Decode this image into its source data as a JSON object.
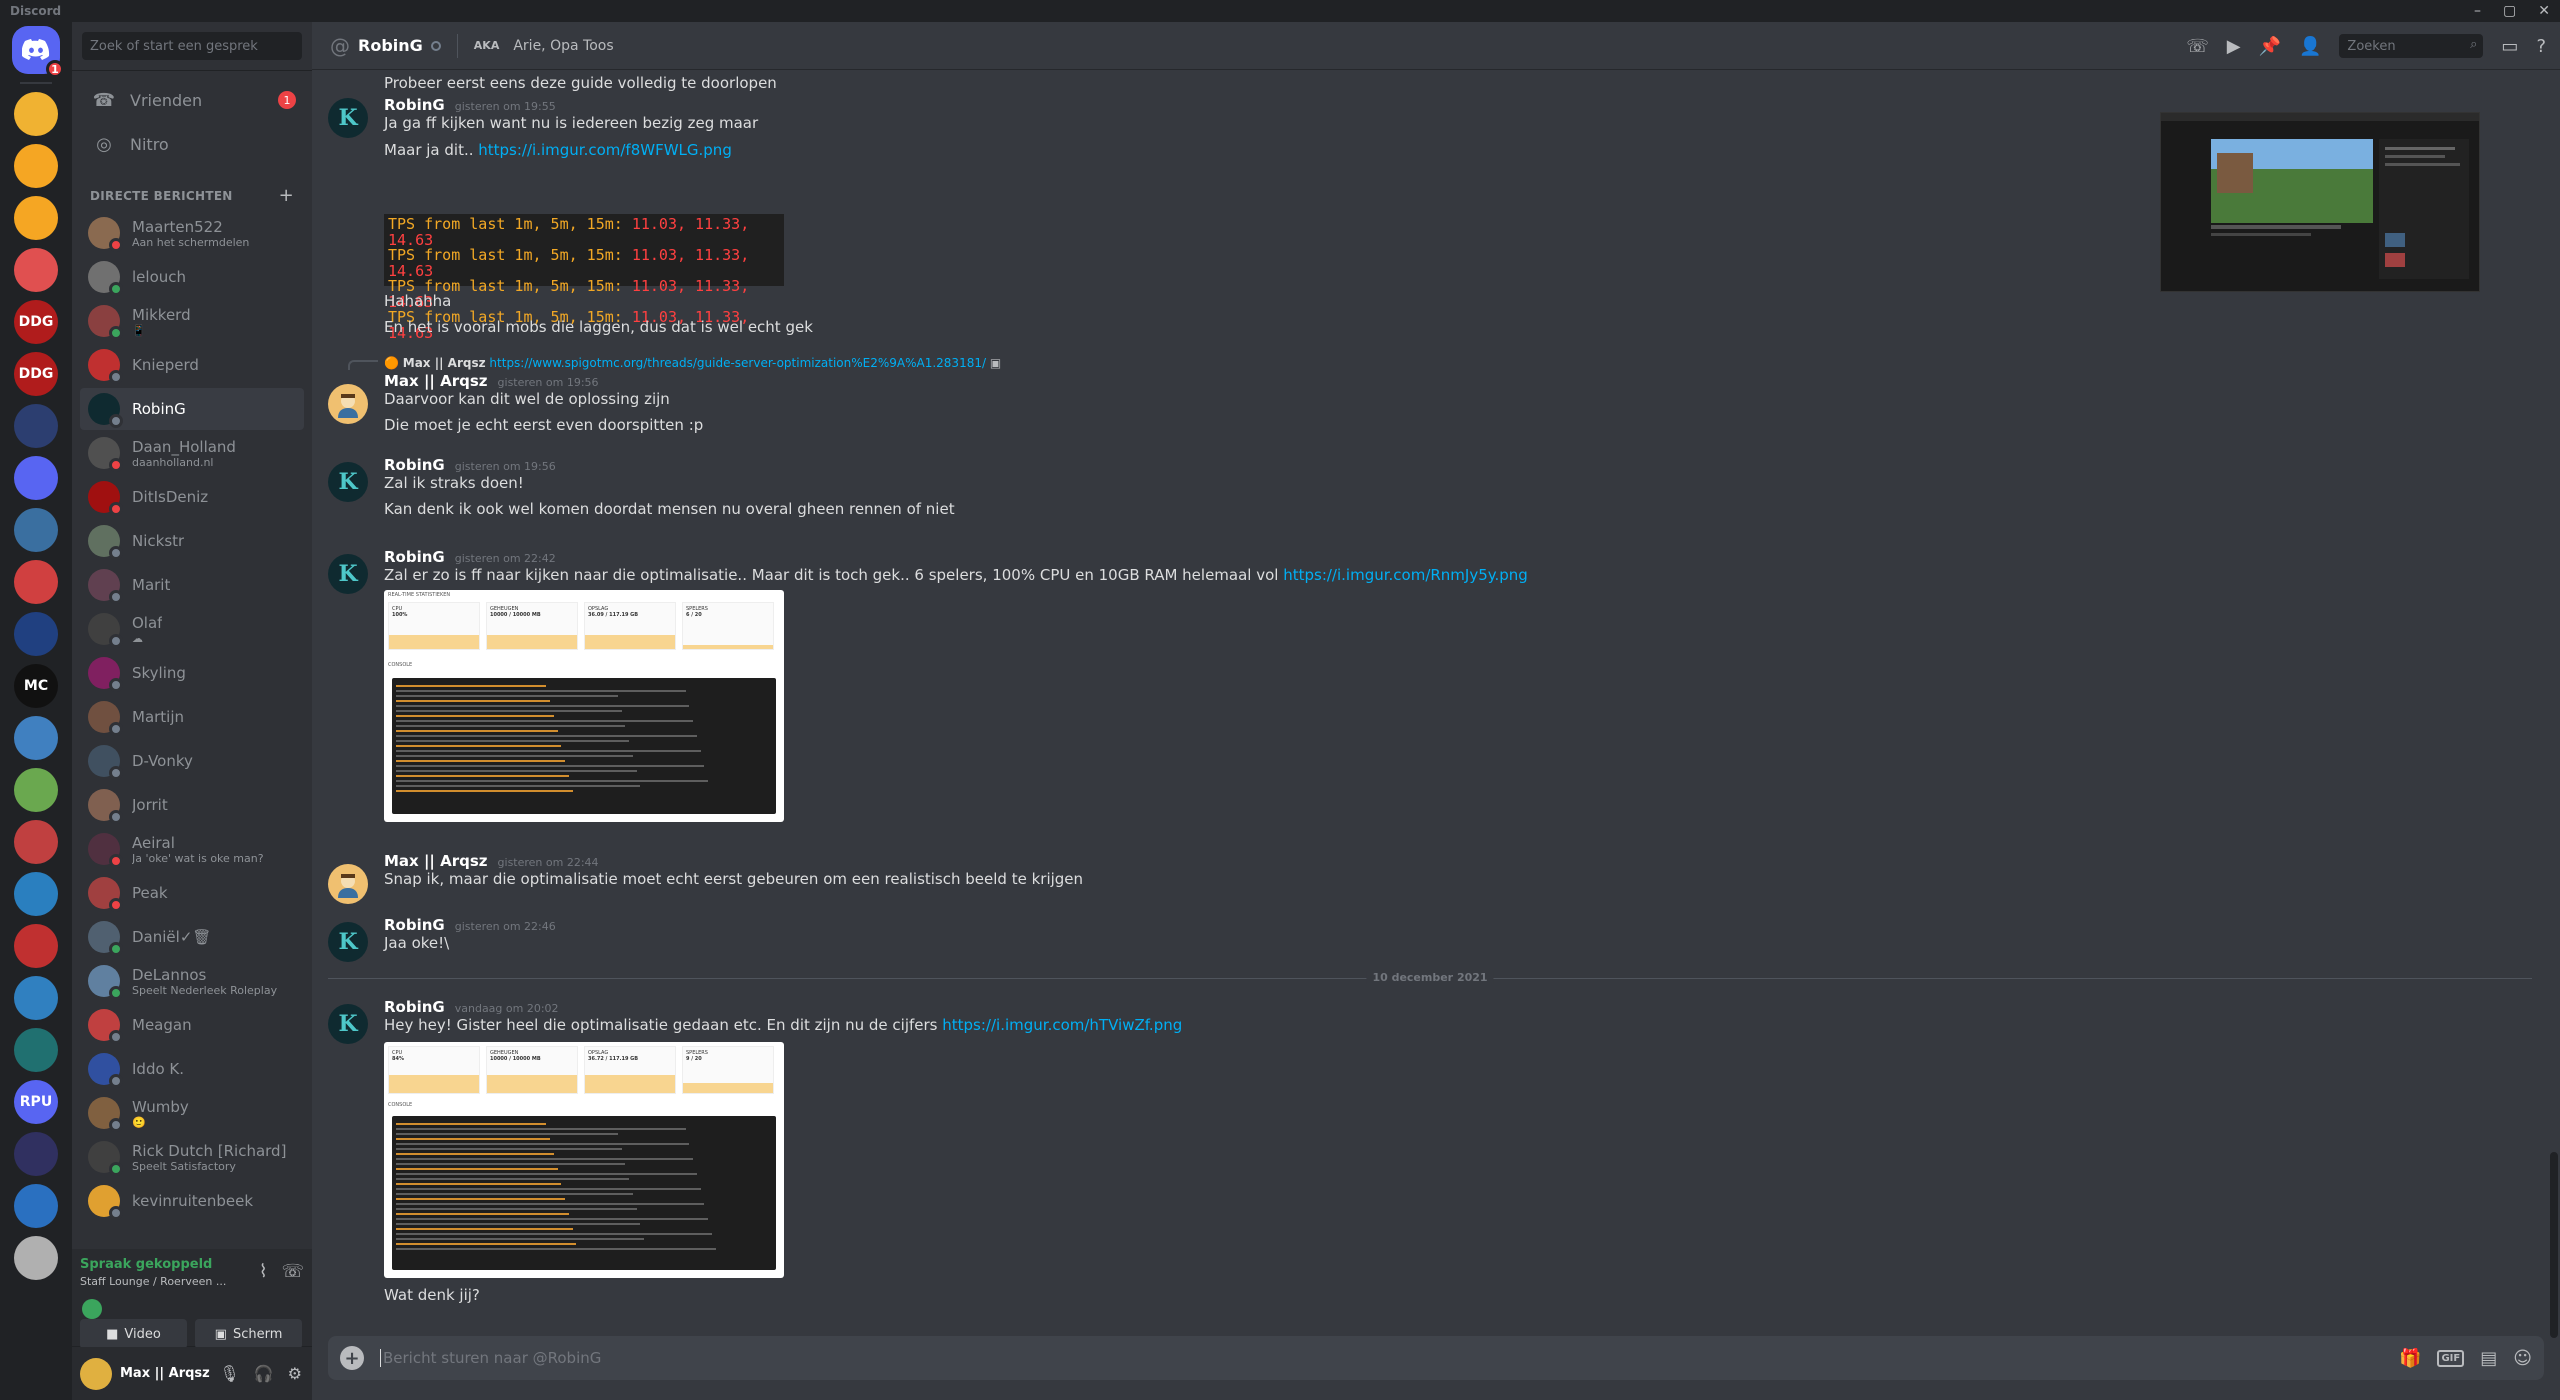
{
  "app": {
    "title": "Discord"
  },
  "servers": {
    "home_badge": "1",
    "items": [
      {
        "label": "",
        "color": "#f0b232"
      },
      {
        "label": "",
        "color": "#f5a623"
      },
      {
        "label": "",
        "color": "#f5a623"
      },
      {
        "label": "",
        "color": "#e05050"
      },
      {
        "label": "DDG",
        "color": "#b01c1c"
      },
      {
        "label": "DDG",
        "color": "#b01c1c"
      },
      {
        "label": "",
        "color": "#2c3e70"
      },
      {
        "label": "",
        "color": "#5865f2"
      },
      {
        "label": "",
        "color": "#3a6fa0"
      },
      {
        "label": "",
        "color": "#d04040"
      },
      {
        "label": "",
        "color": "#204080"
      },
      {
        "label": "MC",
        "color": "#111111"
      },
      {
        "label": "",
        "color": "#4080c0"
      },
      {
        "label": "",
        "color": "#6aa84f"
      },
      {
        "label": "",
        "color": "#c04040"
      },
      {
        "label": "",
        "color": "#2a7fbf"
      },
      {
        "label": "",
        "color": "#c03030"
      },
      {
        "label": "",
        "color": "#3080c0"
      },
      {
        "label": "",
        "color": "#207070"
      },
      {
        "label": "RPU",
        "color": "#5865f2"
      },
      {
        "label": "",
        "color": "#303060"
      },
      {
        "label": "",
        "color": "#2a70c0"
      },
      {
        "label": "",
        "color": "#b0b0b0"
      }
    ]
  },
  "dm": {
    "search_placeholder": "Zoek of start een gesprek",
    "friends_label": "Vrienden",
    "friends_badge": "1",
    "nitro_label": "Nitro",
    "header": "DIRECTE BERICHTEN",
    "items": [
      {
        "name": "Maarten522",
        "sub": "Aan het schermdelen",
        "color": "#8a6a50",
        "status": "#ed4245"
      },
      {
        "name": "lelouch",
        "sub": "",
        "color": "#707070",
        "status": "#3ba55d"
      },
      {
        "name": "Mikkerd",
        "sub": "📱",
        "color": "#8a4040",
        "status": "#3ba55d"
      },
      {
        "name": "Knieperd",
        "sub": "",
        "color": "#c03030",
        "status": "#747f8d"
      },
      {
        "name": "RobinG",
        "sub": "",
        "color": "#0f2a30",
        "status": "#747f8d"
      },
      {
        "name": "Daan_Holland",
        "sub": "daanholland.nl",
        "color": "#505050",
        "status": "#ed4245"
      },
      {
        "name": "DitIsDeniz",
        "sub": "",
        "color": "#a01010",
        "status": "#ed4245"
      },
      {
        "name": "Nickstr",
        "sub": "",
        "color": "#607060",
        "status": "#747f8d"
      },
      {
        "name": "Marit",
        "sub": "",
        "color": "#604050",
        "status": "#747f8d"
      },
      {
        "name": "Olaf",
        "sub": "☁",
        "color": "#404040",
        "status": "#747f8d"
      },
      {
        "name": "Skyling",
        "sub": "",
        "color": "#802060",
        "status": "#747f8d"
      },
      {
        "name": "Martijn",
        "sub": "",
        "color": "#705040",
        "status": "#747f8d"
      },
      {
        "name": "D-Vonky",
        "sub": "",
        "color": "#405060",
        "status": "#747f8d"
      },
      {
        "name": "Jorrit",
        "sub": "",
        "color": "#806050",
        "status": "#747f8d"
      },
      {
        "name": "Aeiral",
        "sub": "Ja 'oke' wat is oke man?",
        "color": "#503040",
        "status": "#ed4245"
      },
      {
        "name": "Peak",
        "sub": "",
        "color": "#a04040",
        "status": "#ed4245"
      },
      {
        "name": "Daniël✓🗑",
        "sub": "",
        "color": "#506070",
        "status": "#3ba55d"
      },
      {
        "name": "DeLannos",
        "sub": "Speelt Nederleek Roleplay",
        "color": "#6080a0",
        "status": "#3ba55d"
      },
      {
        "name": "Meagan",
        "sub": "",
        "color": "#c04040",
        "status": "#747f8d"
      },
      {
        "name": "Iddo K.",
        "sub": "",
        "color": "#3050a0",
        "status": "#747f8d"
      },
      {
        "name": "Wumby",
        "sub": "🙂",
        "color": "#806040",
        "status": "#747f8d"
      },
      {
        "name": "Rick Dutch [Richard]",
        "sub": "Speelt Satisfactory",
        "color": "#404040",
        "status": "#3ba55d"
      },
      {
        "name": "kevinruitenbeek",
        "sub": "",
        "color": "#e0a030",
        "status": "#747f8d"
      }
    ]
  },
  "voice": {
    "title": "Spraak gekoppeld",
    "sub": "Staff Lounge / Roerveen ...",
    "video_label": "Video",
    "screen_label": "Scherm"
  },
  "user": {
    "name": "Max || Arqsz"
  },
  "channel": {
    "name": "RobinG",
    "aka_label": "AKA",
    "aka": "Arie, Opa Toos",
    "search_placeholder": "Zoeken"
  },
  "messages": {
    "m0_line1": "Probeer eerst eens deze guide volledig te doorlopen",
    "m1_author": "RobinG",
    "m1_time": "gisteren om 19:55",
    "m1_line1": "Ja ga ff  kijken want nu is iedereen  bezig zeg maar",
    "m1_line2_text": "Maar ja dit.. ",
    "m1_line2_link": "https://i.imgur.com/f8WFWLG.png",
    "tps_rows": [
      {
        "label": "TPS from last 1m, 5m, 15m: ",
        "value": "11.03, 11.33, 14.63"
      },
      {
        "label": "TPS from last 1m, 5m, 15m: ",
        "value": "11.03, 11.33, 14.63"
      },
      {
        "label": "TPS from last 1m, 5m, 15m: ",
        "value": "11.03, 11.33, 14.63"
      },
      {
        "label": "TPS from last 1m, 5m, 15m: ",
        "value": "11.03, 11.33, 14.63"
      }
    ],
    "m1_line3": "Hahahha",
    "m1_line4": "En het is vooral mobs die laggen, dus dat is wel echt gek",
    "m2_reply_name": "Max || Arqsz",
    "m2_reply_link": "https://www.spigotmc.org/threads/guide-server-optimization%E2%9A%A1.283181/",
    "m2_author": "Max || Arqsz",
    "m2_time": "gisteren om 19:56",
    "m2_line1": "Daarvoor kan dit wel de oplossing zijn",
    "m2_line2": "Die moet je echt eerst even doorspitten :p",
    "m3_author": "RobinG",
    "m3_time": "gisteren om 19:56",
    "m3_line1": "Zal ik straks doen!",
    "m3_line2": "Kan denk ik ook wel komen doordat  mensen nu overal gheen rennen of niet",
    "m4_author": "RobinG",
    "m4_time": "gisteren om 22:42",
    "m4_text": "Zal er zo is ff naar kijken naar die optimalisatie.. Maar dit is toch gek.. 6 spelers, 100% CPU en 10GB RAM helemaal vol ",
    "m4_link": "https://i.imgur.com/RnmJy5y.png",
    "dash1": {
      "section1": "REAL-TIME STATISTIEKEN",
      "cards": [
        {
          "label": "CPU",
          "value": "100%"
        },
        {
          "label": "GEHEUGEN",
          "value": "10000 / 10000 MB"
        },
        {
          "label": "OPSLAG",
          "value": "36.09 / 117.19 GB"
        },
        {
          "label": "SPELERS",
          "value": "6 / 20"
        }
      ],
      "section2": "CONSOLE"
    },
    "m5_author": "Max || Arqsz",
    "m5_time": "gisteren om 22:44",
    "m5_line1": "Snap ik, maar die optimalisatie moet echt eerst gebeuren om een realistisch beeld te krijgen",
    "m6_author": "RobinG",
    "m6_time": "gisteren om 22:46",
    "m6_line1": "Jaa oke!\\",
    "date_sep": "10 december 2021",
    "m7_author": "RobinG",
    "m7_time": "vandaag om 20:02",
    "m7_text": "Hey hey! Gister heel die optimalisatie gedaan etc. En dit zijn nu de cijfers ",
    "m7_link": "https://i.imgur.com/hTViwZf.png",
    "dash2": {
      "cards": [
        {
          "label": "CPU",
          "value": "84%"
        },
        {
          "label": "GEHEUGEN",
          "value": "10000 / 10000 MB"
        },
        {
          "label": "OPSLAG",
          "value": "36.72 / 117.19 GB"
        },
        {
          "label": "SPELERS",
          "value": "9 / 20"
        }
      ],
      "section2": "CONSOLE"
    },
    "m7_line2": "Wat denk jij?"
  },
  "composer": {
    "placeholder": "Bericht sturen naar @RobinG"
  }
}
